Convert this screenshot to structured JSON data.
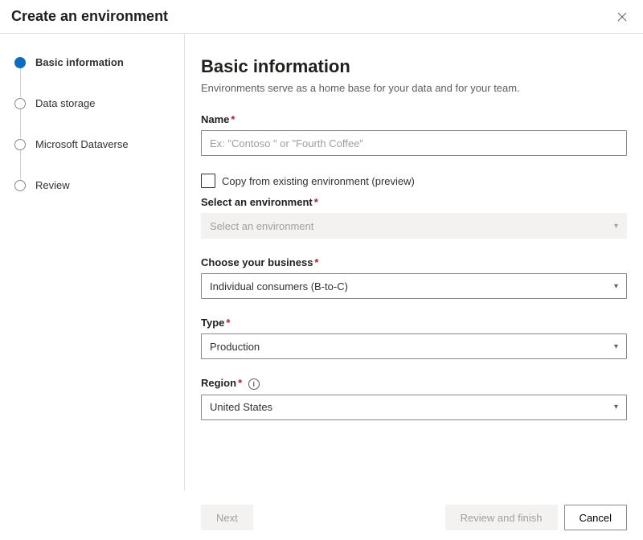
{
  "header": {
    "title": "Create an environment"
  },
  "steps": [
    {
      "label": "Basic information",
      "active": true
    },
    {
      "label": "Data storage",
      "active": false
    },
    {
      "label": "Microsoft Dataverse",
      "active": false
    },
    {
      "label": "Review",
      "active": false
    }
  ],
  "main": {
    "heading": "Basic information",
    "subtitle": "Environments serve as a home base for your data and for your team.",
    "name": {
      "label": "Name",
      "placeholder": "Ex: \"Contoso \" or \"Fourth Coffee\"",
      "value": ""
    },
    "copy_checkbox": {
      "label": "Copy from existing environment (preview)",
      "checked": false
    },
    "select_env": {
      "label": "Select an environment",
      "placeholder": "Select an environment",
      "disabled": true
    },
    "business": {
      "label": "Choose your business",
      "value": "Individual consumers (B-to-C)"
    },
    "type": {
      "label": "Type",
      "value": "Production"
    },
    "region": {
      "label": "Region",
      "value": "United States"
    }
  },
  "footer": {
    "next": "Next",
    "review": "Review and finish",
    "cancel": "Cancel"
  }
}
